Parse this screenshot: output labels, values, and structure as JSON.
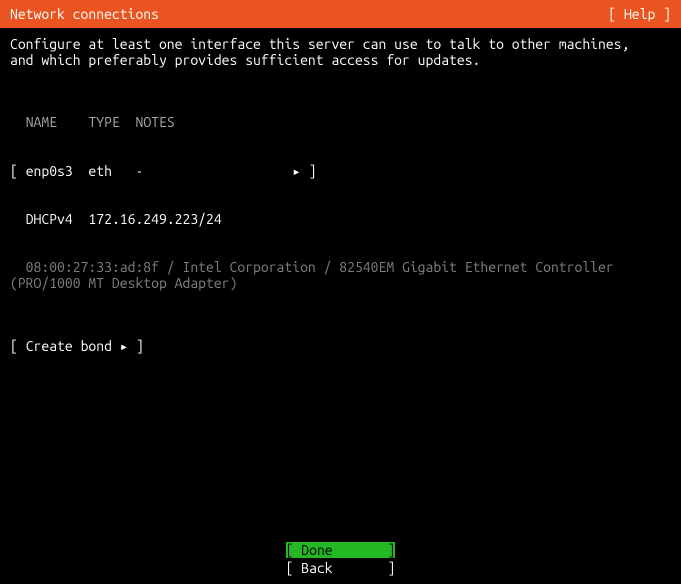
{
  "header": {
    "title": "Network connections",
    "help_label": "[ Help ]"
  },
  "description": "Configure at least one interface this server can use to talk to other machines,\nand which preferably provides sufficient access for updates.",
  "table": {
    "cols": {
      "name": "NAME",
      "type": "TYPE",
      "notes": "NOTES"
    },
    "iface": {
      "open_b": "[ ",
      "name": "enp0s3",
      "type": "eth",
      "notes": "-",
      "arrow": "▸",
      "close_b": " ]"
    },
    "dhcp": {
      "label": "DHCPv4",
      "ip": "172.16.249.223/24"
    },
    "detail": "  08:00:27:33:ad:8f / Intel Corporation / 82540EM Gigabit Ethernet Controller\n(PRO/1000 MT Desktop Adapter)"
  },
  "create_bond": {
    "open_b": "[ ",
    "label": "Create bond",
    "arrow": "▸",
    "close_b": " ]"
  },
  "footer": {
    "done": "[ Done       ]",
    "back": "[ Back       ]"
  }
}
